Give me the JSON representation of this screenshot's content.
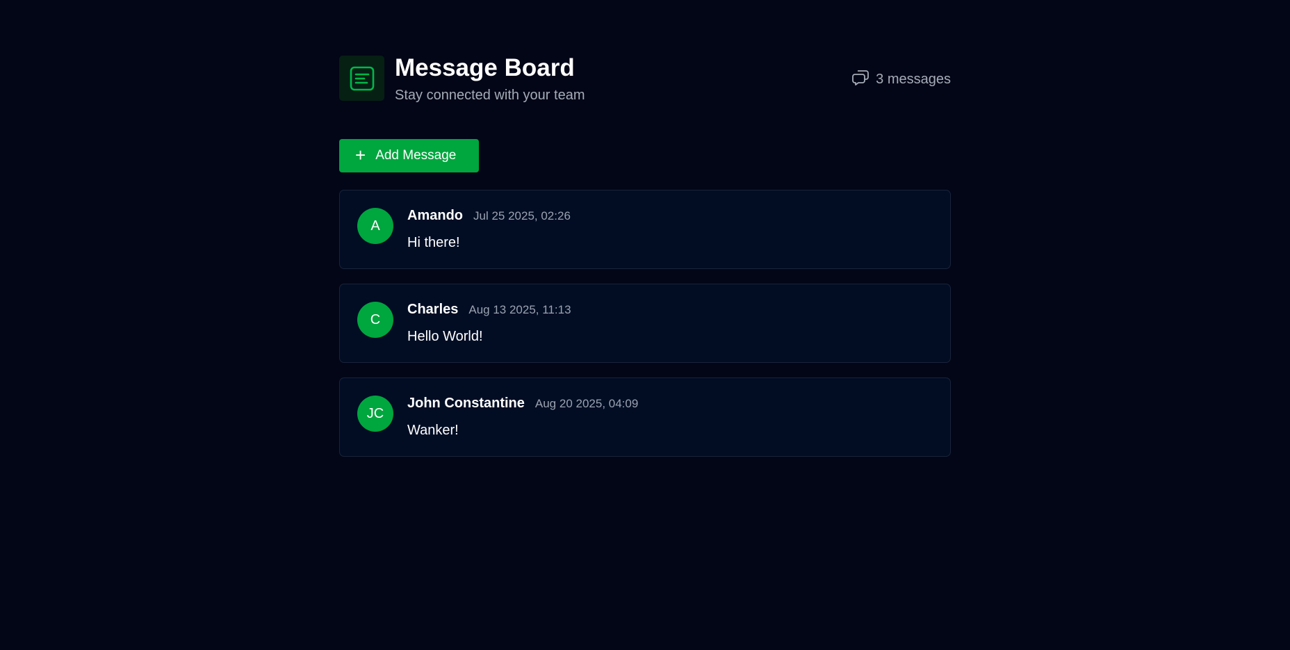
{
  "header": {
    "title": "Message Board",
    "subtitle": "Stay connected with your team",
    "logo_icon": "message-board-icon",
    "count_icon": "chat-bubbles-icon",
    "count_text": "3 messages"
  },
  "actions": {
    "add_label": "Add Message",
    "add_icon": "plus-icon"
  },
  "colors": {
    "background": "#030617",
    "accent": "#00a63e",
    "card": "#020d24"
  },
  "messages": [
    {
      "initials": "A",
      "author": "Amando",
      "time": "Jul 25 2025, 02:26",
      "text": "Hi there!"
    },
    {
      "initials": "C",
      "author": "Charles",
      "time": "Aug 13 2025, 11:13",
      "text": "Hello World!"
    },
    {
      "initials": "JC",
      "author": "John Constantine",
      "time": "Aug 20 2025, 04:09",
      "text": "Wanker!"
    }
  ]
}
